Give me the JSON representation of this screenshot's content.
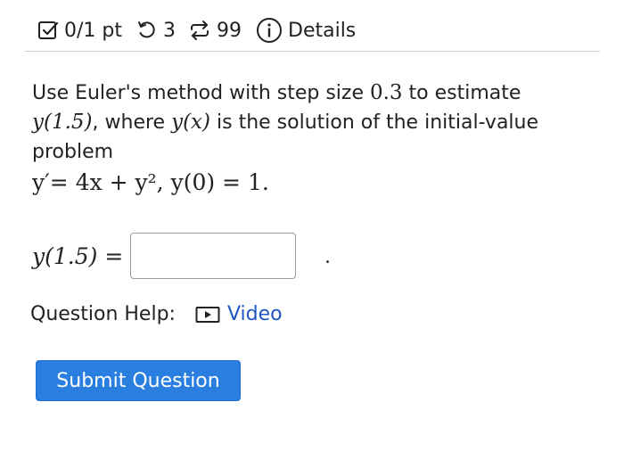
{
  "header": {
    "points": "0/1 pt",
    "retries": "3",
    "submissions": "99",
    "details": "Details",
    "icons": [
      "checkbox-icon",
      "retry-icon",
      "repeat-icon",
      "info-icon"
    ]
  },
  "question": {
    "intro": "Use Euler's method with step size ",
    "step_size": "0.3",
    "to_estimate": " to estimate",
    "target": "y(1.5)",
    "where": ", where ",
    "solution_fn": "y(x)",
    "is_the_solution": " is the solution of the initial-value problem",
    "equation": "y′= 4x + y², y(0) = 1."
  },
  "answer": {
    "label": "y(1.5) =",
    "value": "",
    "period": "."
  },
  "help": {
    "label": "Question Help:",
    "video_label": "Video"
  },
  "submit": {
    "label": "Submit Question"
  },
  "colors": {
    "link": "#1f55c6",
    "button": "#2a7ee0"
  }
}
